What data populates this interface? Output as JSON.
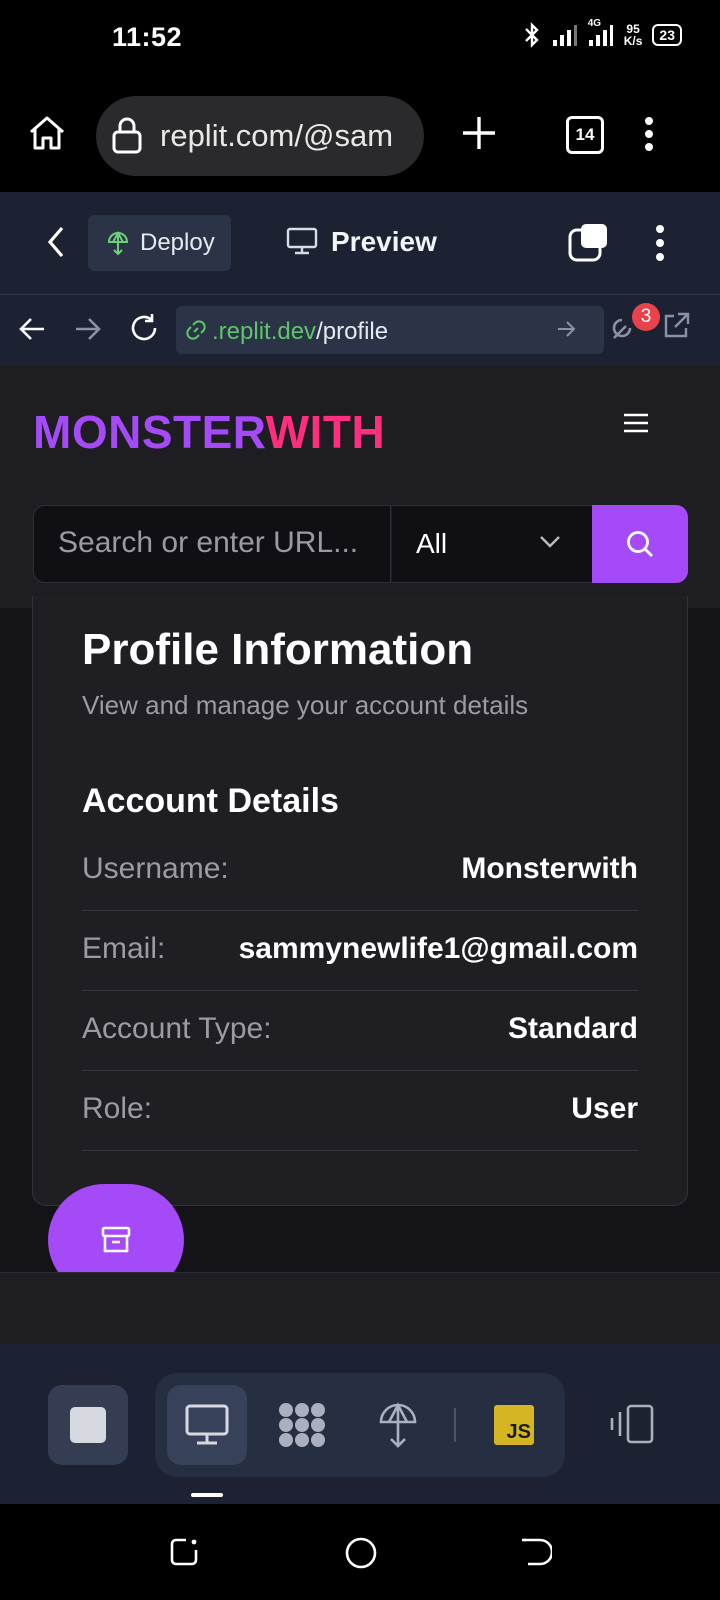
{
  "status_bar": {
    "time": "11:52",
    "net_speed_value": "95",
    "net_speed_unit": "K/s",
    "network_type": "4G",
    "battery": "23",
    "icons": [
      "bluetooth-icon",
      "signal-icon",
      "signal-4g-icon",
      "battery-icon"
    ]
  },
  "browser": {
    "url": "replit.com/@sam",
    "tab_count": "14",
    "icons": [
      "home-icon",
      "lock-icon",
      "new-tab-icon",
      "tabs-icon",
      "menu-icon"
    ]
  },
  "replit": {
    "deploy_label": "Deploy",
    "preview_label": "Preview",
    "url_domain": ".replit.dev",
    "url_path": "/profile",
    "devtools_badge": "3",
    "colors": {
      "bar": "#1c2232",
      "domain_text": "#5fc46c"
    }
  },
  "app": {
    "brand_part1": "MONSTER",
    "brand_part2": "WITH",
    "brand_colors": {
      "part1": "#a54af7",
      "part2": "#ff2e7e"
    },
    "search_placeholder": "Search or enter URL...",
    "category_selected": "All",
    "accent_color": "#a54af7"
  },
  "profile": {
    "title": "Profile Information",
    "subtitle": "View and manage your account details",
    "section_title": "Account Details",
    "rows": [
      {
        "label": "Username:",
        "value": "Monsterwith"
      },
      {
        "label": "Email:",
        "value": "sammynewlife1@gmail.com"
      },
      {
        "label": "Account Type:",
        "value": "Standard"
      },
      {
        "label": "Role:",
        "value": "User"
      }
    ]
  },
  "toolbar": {
    "js_label": "JS",
    "icons": [
      "stop-icon",
      "monitor-icon",
      "extensions-icon",
      "deploy-icon",
      "javascript-icon",
      "split-view-icon"
    ]
  }
}
